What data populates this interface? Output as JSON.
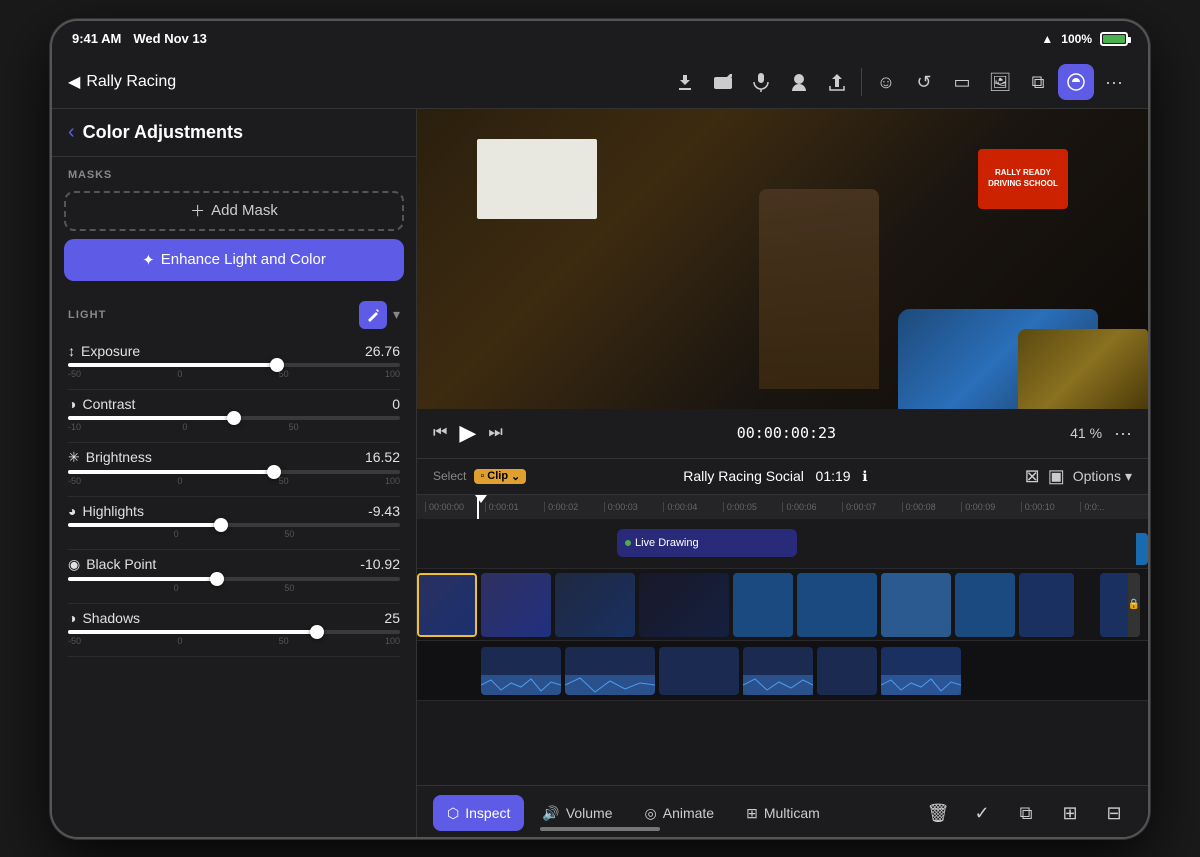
{
  "status": {
    "time": "9:41 AM",
    "date": "Wed Nov 13",
    "battery": "100%",
    "signal": "●●●●"
  },
  "toolbar": {
    "back_label": "◀",
    "title": "Rally Racing",
    "icons": [
      "download",
      "camera",
      "mic",
      "voiceover",
      "share"
    ]
  },
  "panel": {
    "back_label": "‹",
    "title": "Color Adjustments",
    "masks_label": "MASKS",
    "add_mask_label": "Add Mask",
    "enhance_label": "Enhance Light and Color",
    "light_label": "LIGHT",
    "sliders": [
      {
        "name": "Exposure",
        "value": "26.76",
        "percent": 63,
        "icon": "↕",
        "min": "-50",
        "zero": "0",
        "mid": "50",
        "max": "100"
      },
      {
        "name": "Contrast",
        "value": "0",
        "percent": 50,
        "icon": "◑",
        "min": "-10",
        "zero": "0",
        "mid": "50",
        "max": ""
      },
      {
        "name": "Brightness",
        "value": "16.52",
        "percent": 62,
        "icon": "✳",
        "min": "-50",
        "zero": "0",
        "mid": "50",
        "max": "100"
      },
      {
        "name": "Highlights",
        "value": "-9.43",
        "percent": 46,
        "icon": "◕",
        "min": "",
        "zero": "0",
        "mid": "50",
        "max": ""
      },
      {
        "name": "Black Point",
        "value": "-10.92",
        "percent": 45,
        "icon": "◉",
        "min": "",
        "zero": "0",
        "mid": "50",
        "max": ""
      },
      {
        "name": "Shadows",
        "value": "25",
        "percent": 75,
        "icon": "◑",
        "min": "-50",
        "zero": "0",
        "mid": "50",
        "max": "100"
      }
    ]
  },
  "playback": {
    "time": "00:00:00:23",
    "zoom": "41",
    "zoom_unit": "%"
  },
  "timeline": {
    "select_label": "Select",
    "clip_label": "Clip",
    "title": "Rally Racing Social",
    "duration": "01:19",
    "options_label": "Options",
    "ruler_marks": [
      "00:00:00",
      "0:00:01",
      "0:00:02",
      "0:00:03",
      "0:00:04",
      "0:00:05",
      "0:00:06",
      "0:00:07",
      "0:00:08",
      "0:00:09",
      "0:00:10",
      "0:0:.."
    ],
    "live_drawing_label": "Live Drawing"
  },
  "bottom_tabs": [
    {
      "id": "inspect",
      "label": "Inspect",
      "icon": "⬡",
      "active": true
    },
    {
      "id": "volume",
      "label": "Volume",
      "icon": "🔊",
      "active": false
    },
    {
      "id": "animate",
      "label": "Animate",
      "icon": "◎",
      "active": false
    },
    {
      "id": "multicam",
      "label": "Multicam",
      "icon": "⊞",
      "active": false
    }
  ],
  "bottom_actions": [
    "🗑",
    "✓",
    "⧉",
    "⊞",
    "⊟"
  ],
  "colors": {
    "accent": "#5E5CE6",
    "highlight": "#f0c030",
    "track_blue": "#2a5fba",
    "track_dark": "#1a3050"
  }
}
